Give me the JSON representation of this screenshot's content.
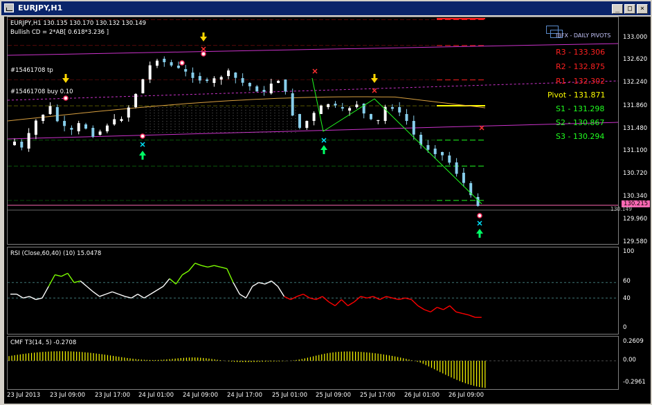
{
  "window": {
    "title": "EURJPY,H1",
    "btn_min": "_",
    "btn_max": "□",
    "btn_close": "×"
  },
  "main": {
    "header_symbol": "EURJPY,H1  130.135 130.170 130.132 130.149",
    "header_pattern": "Bullish CD = 2*AB[ 0.618*3.236 ]",
    "label_tp": "#15461708 tp",
    "label_buy": "#15461708 buy 0.10",
    "logo_text": "IBFX - DAILY PIVOTS",
    "price_ticks": [
      "133.000",
      "132.620",
      "132.240",
      "131.860",
      "131.480",
      "131.100",
      "130.720",
      "130.340",
      "129.960",
      "129.580"
    ],
    "price_tag_current": "130.215",
    "price_tag_bid": "130.149",
    "pivots": [
      {
        "label": "R3 - 133.306",
        "color": "#ff2020"
      },
      {
        "label": "R2 - 132.875",
        "color": "#ff2020"
      },
      {
        "label": "R1 - 132.302",
        "color": "#ff2020"
      },
      {
        "label": "Pivot - 131.871",
        "color": "#ffff00"
      },
      {
        "label": "S1 - 131.298",
        "color": "#20ff20"
      },
      {
        "label": "S2 - 130.867",
        "color": "#20ff20"
      },
      {
        "label": "S3 - 130.294",
        "color": "#20ff20"
      }
    ]
  },
  "rsi": {
    "header": "RSI (Close,60,40) (10) 15.0478",
    "ticks": [
      "100",
      "60",
      "40",
      "0"
    ]
  },
  "cmf": {
    "header": "CMF T3(14, 5) -0.2708",
    "ticks": [
      "0.2609",
      "0.00",
      "-0.2961"
    ]
  },
  "time_axis": [
    "23 Jul 2013",
    "23 Jul 09:00",
    "23 Jul 17:00",
    "24 Jul 01:00",
    "24 Jul 09:00",
    "24 Jul 17:00",
    "25 Jul 01:00",
    "25 Jul 09:00",
    "25 Jul 17:00",
    "26 Jul 01:00",
    "26 Jul 09:00"
  ],
  "colors": {
    "background": "#000000",
    "bull": "#ffffff",
    "bear": "#87ceeb",
    "channel": "#cc33cc",
    "rsi_up": "#7cfc00",
    "rsi_down": "#ff0000",
    "cmf": "#ffff00"
  },
  "icons": [
    "arrow-down-yellow-icon",
    "arrow-up-green-icon",
    "cross-marker-icon",
    "circle-marker-icon"
  ]
}
